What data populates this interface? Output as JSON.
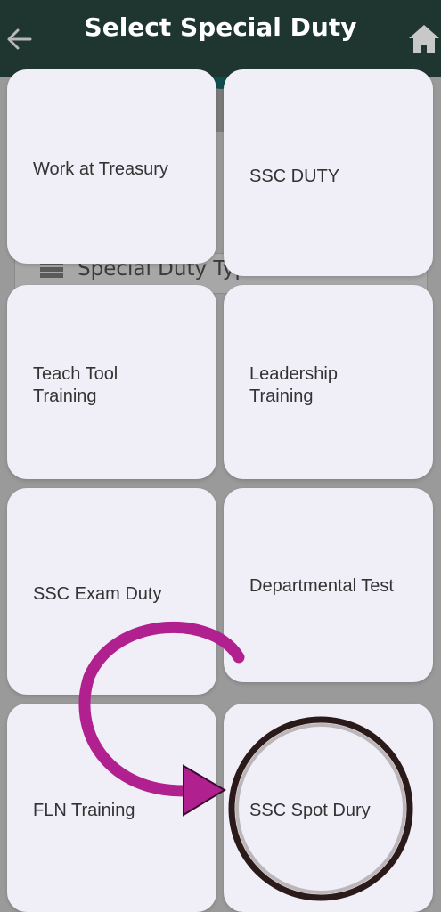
{
  "header": {
    "title": "Select Special Duty",
    "back_icon": "arrow-left-icon",
    "home_icon": "home-icon"
  },
  "background": {
    "field_label": "Special Duty Type"
  },
  "tiles": [
    {
      "label": "Work at Treasury"
    },
    {
      "label": "SSC DUTY"
    },
    {
      "label": "Teach Tool Training"
    },
    {
      "label": "Leadership Training"
    },
    {
      "label": "SSC Exam Duty"
    },
    {
      "label": "Departmental Test"
    },
    {
      "label": "FLN Training"
    },
    {
      "label": "SSC Spot Dury"
    }
  ],
  "colors": {
    "header_bg": "#1e3530",
    "tile_bg": "#f0eff8",
    "arrow": "#b0208f",
    "circle": "#2a1a1a"
  }
}
